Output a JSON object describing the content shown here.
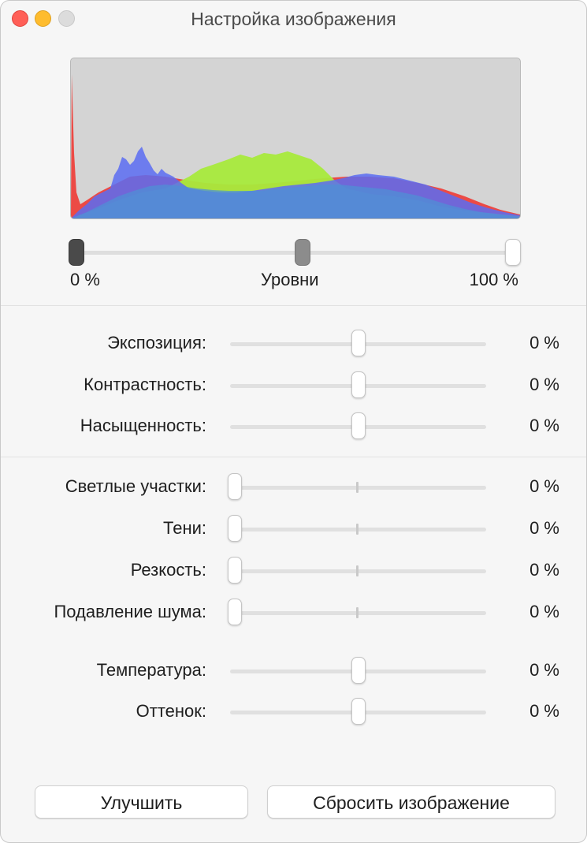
{
  "window": {
    "title": "Настройка изображения"
  },
  "levels": {
    "min_label": "0 %",
    "mid_label": "Уровни",
    "max_label": "100 %"
  },
  "adjustments": [
    {
      "label": "Экспозиция:",
      "value": "0 %",
      "position": 0.5
    },
    {
      "label": "Контрастность:",
      "value": "0 %",
      "position": 0.5
    },
    {
      "label": "Насыщенность:",
      "value": "0 %",
      "position": 0.5
    },
    {
      "label": "Светлые участки:",
      "value": "0 %",
      "position": 0.0
    },
    {
      "label": "Тени:",
      "value": "0 %",
      "position": 0.0
    },
    {
      "label": "Резкость:",
      "value": "0 %",
      "position": 0.0
    },
    {
      "label": "Подавление шума:",
      "value": "0 %",
      "position": 0.0
    },
    {
      "label": "Температура:",
      "value": "0 %",
      "position": 0.5
    },
    {
      "label": "Оттенок:",
      "value": "0 %",
      "position": 0.5
    }
  ],
  "buttons": {
    "enhance": "Улучшить",
    "reset": "Сбросить изображение"
  },
  "colors": {
    "histogram_red": "#ee3b35",
    "histogram_green": "#a8ea3c",
    "histogram_blue": "#5a6cf2",
    "histogram_overlap": "#4f8fd6"
  }
}
